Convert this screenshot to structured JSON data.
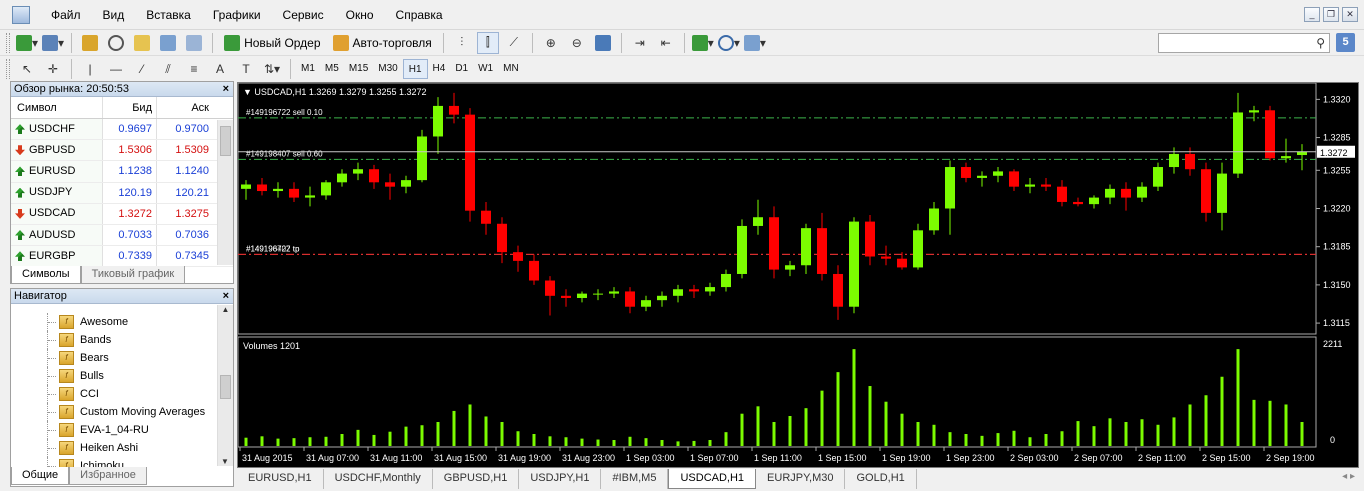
{
  "menu": [
    "Файл",
    "Вид",
    "Вставка",
    "Графики",
    "Сервис",
    "Окно",
    "Справка"
  ],
  "toolbar": {
    "new_order_label": "Новый Ордер",
    "auto_trade_label": "Авто-торговля",
    "timeframes": [
      "M1",
      "M5",
      "M15",
      "M30",
      "H1",
      "H4",
      "D1",
      "W1",
      "MN"
    ],
    "active_timeframe": "H1",
    "notification_count": "5"
  },
  "market_watch": {
    "title": "Обзор рынка: 20:50:53",
    "col_symbol": "Символ",
    "col_bid": "Бид",
    "col_ask": "Аск",
    "rows": [
      {
        "symbol": "USDCHF",
        "bid": "0.9697",
        "ask": "0.9700",
        "dir": "up",
        "color": "blue"
      },
      {
        "symbol": "GBPUSD",
        "bid": "1.5306",
        "ask": "1.5309",
        "dir": "down",
        "color": "red"
      },
      {
        "symbol": "EURUSD",
        "bid": "1.1238",
        "ask": "1.1240",
        "dir": "up",
        "color": "blue"
      },
      {
        "symbol": "USDJPY",
        "bid": "120.19",
        "ask": "120.21",
        "dir": "up",
        "color": "blue"
      },
      {
        "symbol": "USDCAD",
        "bid": "1.3272",
        "ask": "1.3275",
        "dir": "down",
        "color": "red"
      },
      {
        "symbol": "AUDUSD",
        "bid": "0.7033",
        "ask": "0.7036",
        "dir": "up",
        "color": "blue"
      },
      {
        "symbol": "EURGBP",
        "bid": "0.7339",
        "ask": "0.7345",
        "dir": "up",
        "color": "blue"
      }
    ],
    "tabs": [
      "Символы",
      "Тиковый график"
    ]
  },
  "navigator": {
    "title": "Навигатор",
    "items": [
      "Awesome",
      "Bands",
      "Bears",
      "Bulls",
      "CCI",
      "Custom Moving Averages",
      "EVA-1_04-RU",
      "Heiken Ashi",
      "Ichimoku"
    ],
    "tabs": [
      "Общие",
      "Избранное"
    ]
  },
  "chart": {
    "header": "USDCAD,H1  1.3269 1.3279 1.3255 1.3272",
    "current_price_label": "1.3272",
    "price_axis": [
      "1.3320",
      "1.3285",
      "1.3255",
      "1.3220",
      "1.3185",
      "1.3150",
      "1.3115"
    ],
    "order_lines": [
      {
        "label": "#149196722 sell 0.10",
        "price": 1.3303,
        "color": "#3cb44b"
      },
      {
        "label": "#149198407 sell 0.60",
        "price": 1.3265,
        "color": "#3cb44b"
      },
      {
        "label": "#149196722 tp",
        "price": 1.3178,
        "color": "#e03030"
      },
      {
        "label": "#149198407 tp",
        "price": 1.3178,
        "color": "#e03030"
      }
    ],
    "volumes_label": "Volumes 1201",
    "volume_axis": [
      "2211",
      "0"
    ],
    "time_labels": [
      "31 Aug 2015",
      "31 Aug 07:00",
      "31 Aug 11:00",
      "31 Aug 15:00",
      "31 Aug 19:00",
      "31 Aug 23:00",
      "1 Sep 03:00",
      "1 Sep 07:00",
      "1 Sep 11:00",
      "1 Sep 15:00",
      "1 Sep 19:00",
      "1 Sep 23:00",
      "2 Sep 03:00",
      "2 Sep 07:00",
      "2 Sep 11:00",
      "2 Sep 15:00",
      "2 Sep 19:00"
    ]
  },
  "chart_data": {
    "type": "candlestick",
    "symbol": "USDCAD",
    "timeframe": "H1",
    "ylim": [
      1.3105,
      1.3335
    ],
    "volume_max": 2211,
    "candles": [
      {
        "o": 1.3238,
        "h": 1.3246,
        "l": 1.3228,
        "c": 1.3242
      },
      {
        "o": 1.3242,
        "h": 1.3248,
        "l": 1.3232,
        "c": 1.3236
      },
      {
        "o": 1.3236,
        "h": 1.3244,
        "l": 1.323,
        "c": 1.3238
      },
      {
        "o": 1.3238,
        "h": 1.3244,
        "l": 1.3226,
        "c": 1.323
      },
      {
        "o": 1.323,
        "h": 1.324,
        "l": 1.3222,
        "c": 1.3232
      },
      {
        "o": 1.3232,
        "h": 1.3246,
        "l": 1.3228,
        "c": 1.3244
      },
      {
        "o": 1.3244,
        "h": 1.3256,
        "l": 1.324,
        "c": 1.3252
      },
      {
        "o": 1.3252,
        "h": 1.3262,
        "l": 1.3246,
        "c": 1.3256
      },
      {
        "o": 1.3256,
        "h": 1.326,
        "l": 1.3238,
        "c": 1.3244
      },
      {
        "o": 1.3244,
        "h": 1.3252,
        "l": 1.3228,
        "c": 1.324
      },
      {
        "o": 1.324,
        "h": 1.325,
        "l": 1.3234,
        "c": 1.3246
      },
      {
        "o": 1.3246,
        "h": 1.3292,
        "l": 1.3244,
        "c": 1.3286
      },
      {
        "o": 1.3286,
        "h": 1.3322,
        "l": 1.327,
        "c": 1.3314
      },
      {
        "o": 1.3314,
        "h": 1.3326,
        "l": 1.3298,
        "c": 1.3306
      },
      {
        "o": 1.3306,
        "h": 1.3312,
        "l": 1.3208,
        "c": 1.3218
      },
      {
        "o": 1.3218,
        "h": 1.3226,
        "l": 1.3196,
        "c": 1.3206
      },
      {
        "o": 1.3206,
        "h": 1.3212,
        "l": 1.317,
        "c": 1.318
      },
      {
        "o": 1.318,
        "h": 1.3186,
        "l": 1.3162,
        "c": 1.3172
      },
      {
        "o": 1.3172,
        "h": 1.3178,
        "l": 1.315,
        "c": 1.3154
      },
      {
        "o": 1.3154,
        "h": 1.3158,
        "l": 1.3122,
        "c": 1.314
      },
      {
        "o": 1.314,
        "h": 1.3146,
        "l": 1.313,
        "c": 1.3138
      },
      {
        "o": 1.3138,
        "h": 1.3144,
        "l": 1.3134,
        "c": 1.3142
      },
      {
        "o": 1.3142,
        "h": 1.3146,
        "l": 1.3136,
        "c": 1.3142
      },
      {
        "o": 1.3142,
        "h": 1.3148,
        "l": 1.3138,
        "c": 1.3144
      },
      {
        "o": 1.3144,
        "h": 1.3148,
        "l": 1.3124,
        "c": 1.313
      },
      {
        "o": 1.313,
        "h": 1.314,
        "l": 1.3126,
        "c": 1.3136
      },
      {
        "o": 1.3136,
        "h": 1.3144,
        "l": 1.313,
        "c": 1.314
      },
      {
        "o": 1.314,
        "h": 1.315,
        "l": 1.3134,
        "c": 1.3146
      },
      {
        "o": 1.3146,
        "h": 1.315,
        "l": 1.3138,
        "c": 1.3144
      },
      {
        "o": 1.3144,
        "h": 1.3152,
        "l": 1.314,
        "c": 1.3148
      },
      {
        "o": 1.3148,
        "h": 1.3164,
        "l": 1.3144,
        "c": 1.316
      },
      {
        "o": 1.316,
        "h": 1.321,
        "l": 1.3156,
        "c": 1.3204
      },
      {
        "o": 1.3204,
        "h": 1.3228,
        "l": 1.3196,
        "c": 1.3212
      },
      {
        "o": 1.3212,
        "h": 1.3222,
        "l": 1.3156,
        "c": 1.3164
      },
      {
        "o": 1.3164,
        "h": 1.3172,
        "l": 1.3158,
        "c": 1.3168
      },
      {
        "o": 1.3168,
        "h": 1.3206,
        "l": 1.316,
        "c": 1.3202
      },
      {
        "o": 1.3202,
        "h": 1.3216,
        "l": 1.3154,
        "c": 1.316
      },
      {
        "o": 1.316,
        "h": 1.3168,
        "l": 1.3118,
        "c": 1.313
      },
      {
        "o": 1.313,
        "h": 1.3212,
        "l": 1.3124,
        "c": 1.3208
      },
      {
        "o": 1.3208,
        "h": 1.3214,
        "l": 1.3168,
        "c": 1.3176
      },
      {
        "o": 1.3176,
        "h": 1.3186,
        "l": 1.3168,
        "c": 1.3174
      },
      {
        "o": 1.3174,
        "h": 1.318,
        "l": 1.3164,
        "c": 1.3166
      },
      {
        "o": 1.3166,
        "h": 1.3206,
        "l": 1.3164,
        "c": 1.32
      },
      {
        "o": 1.32,
        "h": 1.3226,
        "l": 1.3196,
        "c": 1.322
      },
      {
        "o": 1.322,
        "h": 1.3264,
        "l": 1.3196,
        "c": 1.3258
      },
      {
        "o": 1.3258,
        "h": 1.3262,
        "l": 1.3244,
        "c": 1.3248
      },
      {
        "o": 1.3248,
        "h": 1.3254,
        "l": 1.324,
        "c": 1.325
      },
      {
        "o": 1.325,
        "h": 1.3258,
        "l": 1.3244,
        "c": 1.3254
      },
      {
        "o": 1.3254,
        "h": 1.3256,
        "l": 1.3236,
        "c": 1.324
      },
      {
        "o": 1.324,
        "h": 1.3248,
        "l": 1.3234,
        "c": 1.3242
      },
      {
        "o": 1.3242,
        "h": 1.3248,
        "l": 1.3236,
        "c": 1.324
      },
      {
        "o": 1.324,
        "h": 1.3246,
        "l": 1.3222,
        "c": 1.3226
      },
      {
        "o": 1.3226,
        "h": 1.323,
        "l": 1.3222,
        "c": 1.3224
      },
      {
        "o": 1.3224,
        "h": 1.3232,
        "l": 1.322,
        "c": 1.323
      },
      {
        "o": 1.323,
        "h": 1.3242,
        "l": 1.3224,
        "c": 1.3238
      },
      {
        "o": 1.3238,
        "h": 1.3244,
        "l": 1.3218,
        "c": 1.323
      },
      {
        "o": 1.323,
        "h": 1.3244,
        "l": 1.3226,
        "c": 1.324
      },
      {
        "o": 1.324,
        "h": 1.3262,
        "l": 1.3236,
        "c": 1.3258
      },
      {
        "o": 1.3258,
        "h": 1.3276,
        "l": 1.3252,
        "c": 1.327
      },
      {
        "o": 1.327,
        "h": 1.3276,
        "l": 1.325,
        "c": 1.3256
      },
      {
        "o": 1.3256,
        "h": 1.3262,
        "l": 1.3208,
        "c": 1.3216
      },
      {
        "o": 1.3216,
        "h": 1.3262,
        "l": 1.32,
        "c": 1.3252
      },
      {
        "o": 1.3252,
        "h": 1.3326,
        "l": 1.3248,
        "c": 1.3308
      },
      {
        "o": 1.3308,
        "h": 1.3314,
        "l": 1.33,
        "c": 1.331
      },
      {
        "o": 1.331,
        "h": 1.3314,
        "l": 1.3264,
        "c": 1.3266
      },
      {
        "o": 1.3266,
        "h": 1.3284,
        "l": 1.3262,
        "c": 1.3268
      },
      {
        "o": 1.3269,
        "h": 1.3279,
        "l": 1.3255,
        "c": 1.3272
      }
    ],
    "volumes": [
      180,
      210,
      160,
      170,
      190,
      200,
      260,
      350,
      240,
      310,
      420,
      450,
      520,
      760,
      900,
      640,
      520,
      320,
      260,
      210,
      190,
      160,
      140,
      130,
      200,
      170,
      130,
      100,
      110,
      130,
      300,
      700,
      860,
      520,
      650,
      820,
      1200,
      1600,
      2100,
      1300,
      960,
      700,
      520,
      460,
      300,
      260,
      220,
      280,
      330,
      190,
      260,
      320,
      540,
      430,
      600,
      520,
      580,
      460,
      620,
      900,
      1100,
      1500,
      2100,
      1000,
      980,
      900,
      520
    ]
  }
}
